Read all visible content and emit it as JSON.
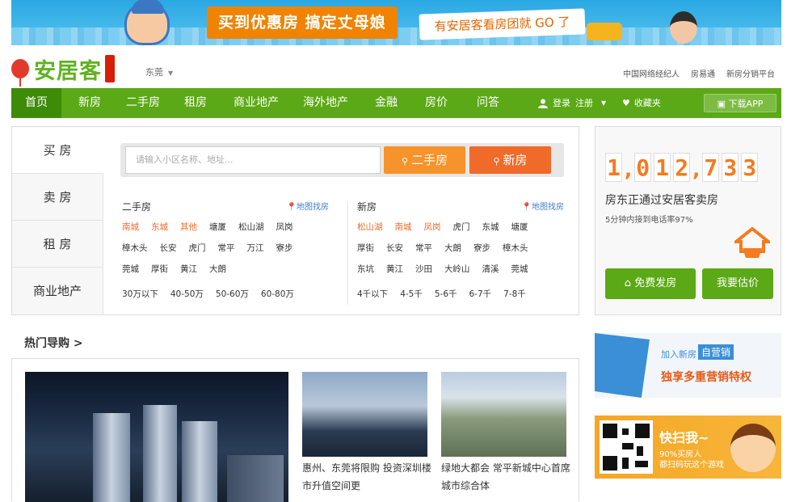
{
  "banner": {
    "title": "买到优惠房  搞定丈母娘",
    "slogan": "有安居客看房团就 GO 了"
  },
  "header": {
    "logo": "安居客",
    "city": "东莞",
    "links": [
      "中国网络经纪人",
      "房易通",
      "新房分销平台"
    ]
  },
  "nav": {
    "items": [
      "首页",
      "新房",
      "二手房",
      "租房",
      "商业地产",
      "海外地产",
      "金融",
      "房价",
      "问答"
    ],
    "login": "登录",
    "register": "注册",
    "favorites": "收藏夹",
    "app": "下载APP"
  },
  "search": {
    "tabs": [
      "买  房",
      "卖  房",
      "租  房",
      "商业地产"
    ],
    "placeholder": "请输入小区名称、地址...",
    "btn_used": "二手房",
    "btn_new": "新房",
    "used": {
      "title": "二手房",
      "map": "地图找房",
      "rows": [
        [
          "南城",
          "东城",
          "其他",
          "塘厦",
          "松山湖",
          "凤岗"
        ],
        [
          "樟木头",
          "长安",
          "虎门",
          "常平",
          "万江",
          "寮步"
        ],
        [
          "莞城",
          "厚街",
          "黄江",
          "大朗"
        ],
        [
          "30万以下",
          "40-50万",
          "50-60万",
          "60-80万"
        ]
      ]
    },
    "new": {
      "title": "新房",
      "map": "地图找房",
      "rows": [
        [
          "松山湖",
          "南城",
          "凤岗",
          "虎门",
          "东城",
          "塘厦"
        ],
        [
          "厚街",
          "长安",
          "常平",
          "大朗",
          "寮步",
          "樟木头"
        ],
        [
          "东坑",
          "黄江",
          "沙田",
          "大岭山",
          "清溪",
          "莞城"
        ],
        [
          "4千以下",
          "4-5千",
          "5-6千",
          "6-7千",
          "7-8千"
        ]
      ]
    }
  },
  "seller": {
    "digits": [
      "1",
      "0",
      "1",
      "2",
      "7",
      "3",
      "3"
    ],
    "text": "房东正通过安居客卖房",
    "sub": "5分钟内接到电话率97%",
    "btn_free": "免费发房",
    "btn_estimate": "我要估价"
  },
  "hot": {
    "title": "热门导购 >",
    "caption2": "惠州、东莞将限购 投资深圳楼市升值空间更",
    "caption3": "绿地大都会 常平新城中心首席城市综合体"
  },
  "ads": {
    "ad1_line1": "加入新房",
    "ad1_tag": "自营销",
    "ad1_line2": "独享多重营销特权",
    "ad2_title": "快扫我~",
    "ad2_line1": "90%买房人",
    "ad2_line2": "都扫码玩这个游戏"
  }
}
